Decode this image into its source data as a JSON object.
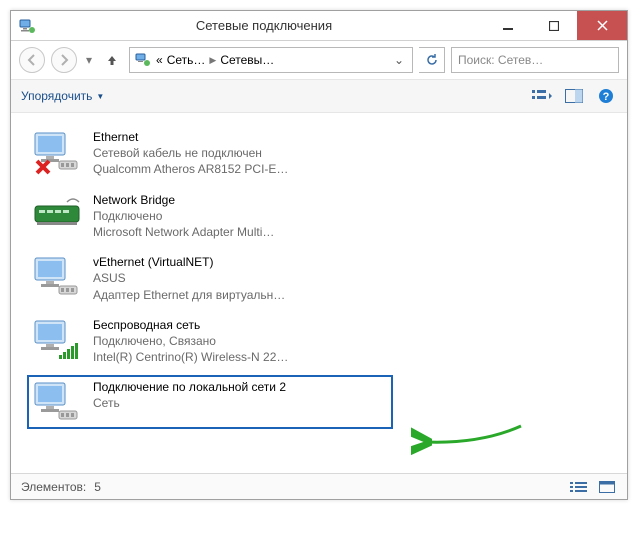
{
  "window": {
    "title": "Сетевые подключения"
  },
  "nav": {
    "breadcrumb": {
      "prefix": "«",
      "seg1": "Сеть…",
      "seg2": "Сетевы…"
    },
    "refresh_icon": "↻"
  },
  "search": {
    "placeholder": "Поиск: Сетев…"
  },
  "toolbar": {
    "organize_label": "Упорядочить"
  },
  "connections": [
    {
      "name": "Ethernet",
      "status": "Сетевой кабель не подключен",
      "device": "Qualcomm Atheros AR8152 PCI-E…",
      "icon": "ethernet-disconnected",
      "selected": false
    },
    {
      "name": "Network Bridge",
      "status": "Подключено",
      "device": "Microsoft Network Adapter Multi…",
      "icon": "bridge",
      "selected": false
    },
    {
      "name": "vEthernet (VirtualNET)",
      "status": "ASUS",
      "device": "Адаптер Ethernet для виртуальн…",
      "icon": "ethernet",
      "selected": false
    },
    {
      "name": "Беспроводная сеть",
      "status": "Подключено, Связано",
      "device": "Intel(R) Centrino(R) Wireless-N 22…",
      "icon": "wifi",
      "selected": false
    },
    {
      "name": "Подключение по локальной сети 2",
      "status": "",
      "device": "Сеть",
      "icon": "ethernet",
      "selected": true
    }
  ],
  "statusbar": {
    "elements_label": "Элементов:",
    "count": "5"
  }
}
